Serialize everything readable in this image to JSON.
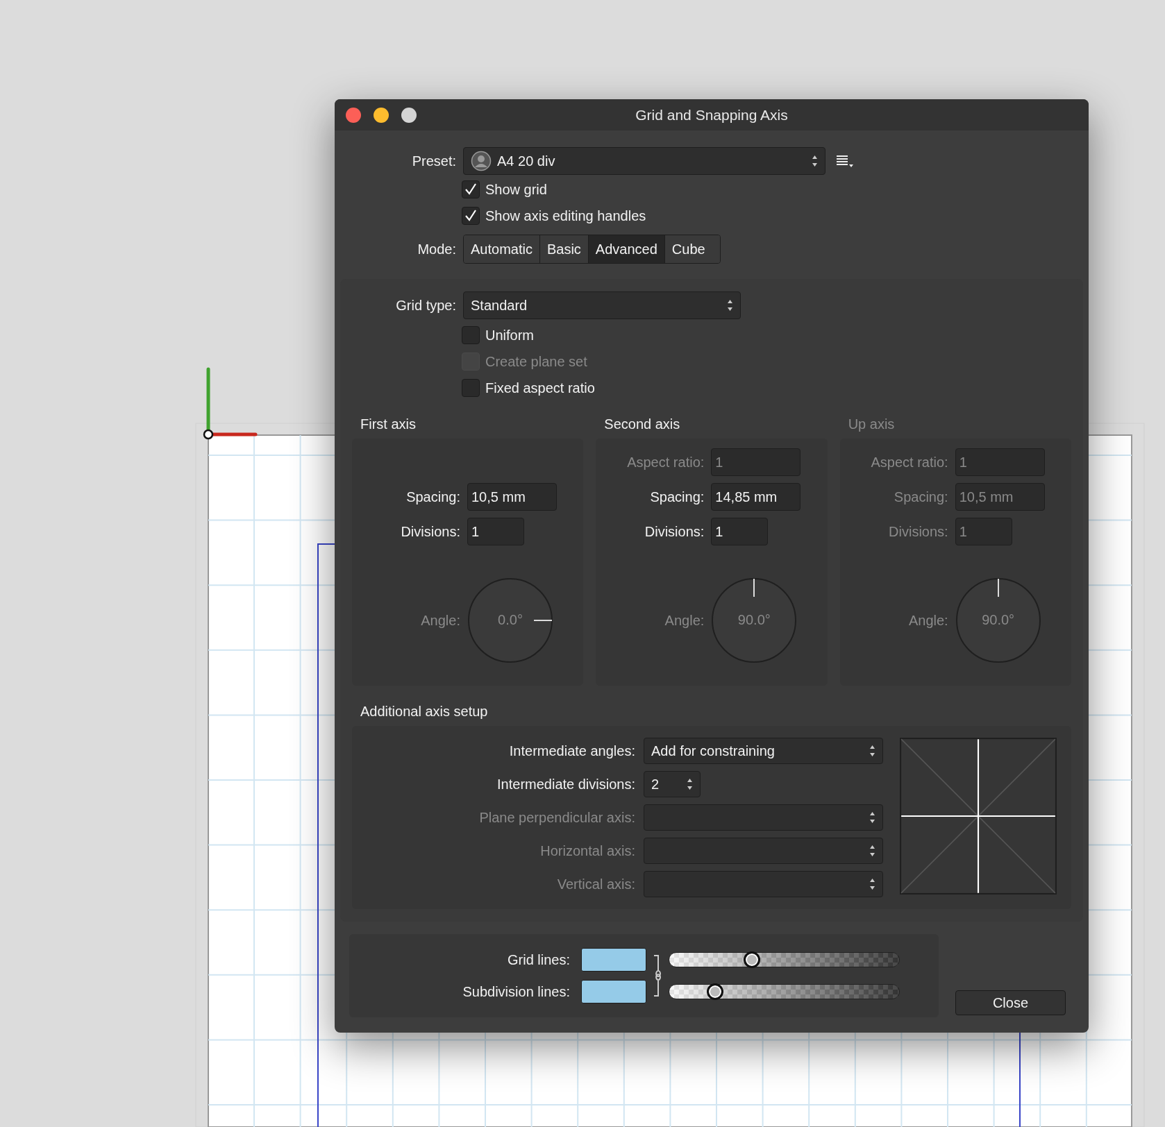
{
  "window": {
    "title": "Grid and Snapping Axis"
  },
  "preset": {
    "label": "Preset:",
    "value": "A4 20 div"
  },
  "display_options": [
    {
      "label": "Show grid",
      "checked": true,
      "disabled": false
    },
    {
      "label": "Show axis editing handles",
      "checked": true,
      "disabled": false
    }
  ],
  "mode": {
    "label": "Mode:",
    "tabs": [
      {
        "label": "Automatic",
        "selected": false
      },
      {
        "label": "Basic",
        "selected": false
      },
      {
        "label": "Advanced",
        "selected": true
      },
      {
        "label": "Cube",
        "selected": false
      }
    ]
  },
  "grid_type": {
    "label": "Grid type:",
    "value": "Standard"
  },
  "grid_options": [
    {
      "label": "Uniform",
      "checked": false,
      "disabled": false
    },
    {
      "label": "Create plane set",
      "checked": false,
      "disabled": true
    },
    {
      "label": "Fixed aspect ratio",
      "checked": false,
      "disabled": false
    }
  ],
  "axes": [
    {
      "title": "First axis",
      "disabled": false,
      "fields": [
        {
          "kind": "measure",
          "label": "Spacing:",
          "value": "10,5 mm",
          "disabled": false
        },
        {
          "kind": "count",
          "label": "Divisions:",
          "value": "1",
          "disabled": false
        }
      ],
      "angle": {
        "label": "Angle:",
        "value": "0.0°"
      }
    },
    {
      "title": "Second axis",
      "disabled": false,
      "fields": [
        {
          "kind": "measure",
          "label": "Aspect ratio:",
          "value": "1",
          "disabled": true
        },
        {
          "kind": "measure",
          "label": "Spacing:",
          "value": "14,85 mm",
          "disabled": false
        },
        {
          "kind": "count",
          "label": "Divisions:",
          "value": "1",
          "disabled": false
        }
      ],
      "angle": {
        "label": "Angle:",
        "value": "90.0°"
      }
    },
    {
      "title": "Up axis",
      "disabled": true,
      "fields": [
        {
          "kind": "measure",
          "label": "Aspect ratio:",
          "value": "1",
          "disabled": true
        },
        {
          "kind": "measure",
          "label": "Spacing:",
          "value": "10,5 mm",
          "disabled": true
        },
        {
          "kind": "count",
          "label": "Divisions:",
          "value": "1",
          "disabled": true
        }
      ],
      "angle": {
        "label": "Angle:",
        "value": "90.0°"
      }
    }
  ],
  "additional": {
    "title": "Additional axis setup",
    "rows": [
      {
        "kind": "popup",
        "label": "Intermediate angles:",
        "value": "Add for constraining",
        "disabled": false
      },
      {
        "kind": "stepper",
        "label": "Intermediate divisions:",
        "value": "2",
        "disabled": false
      },
      {
        "kind": "popup",
        "label": "Plane perpendicular axis:",
        "disabled": true
      },
      {
        "kind": "popup",
        "label": "Horizontal axis:",
        "disabled": true
      },
      {
        "kind": "popup",
        "label": "Vertical axis:",
        "disabled": true
      }
    ]
  },
  "line_colors": [
    {
      "label": "Grid lines:",
      "color": "#95cbe8",
      "level": 0.36
    },
    {
      "label": "Subdivision lines:",
      "color": "#95cbe8",
      "level": 0.2
    }
  ],
  "close_button": {
    "label": "Close"
  }
}
